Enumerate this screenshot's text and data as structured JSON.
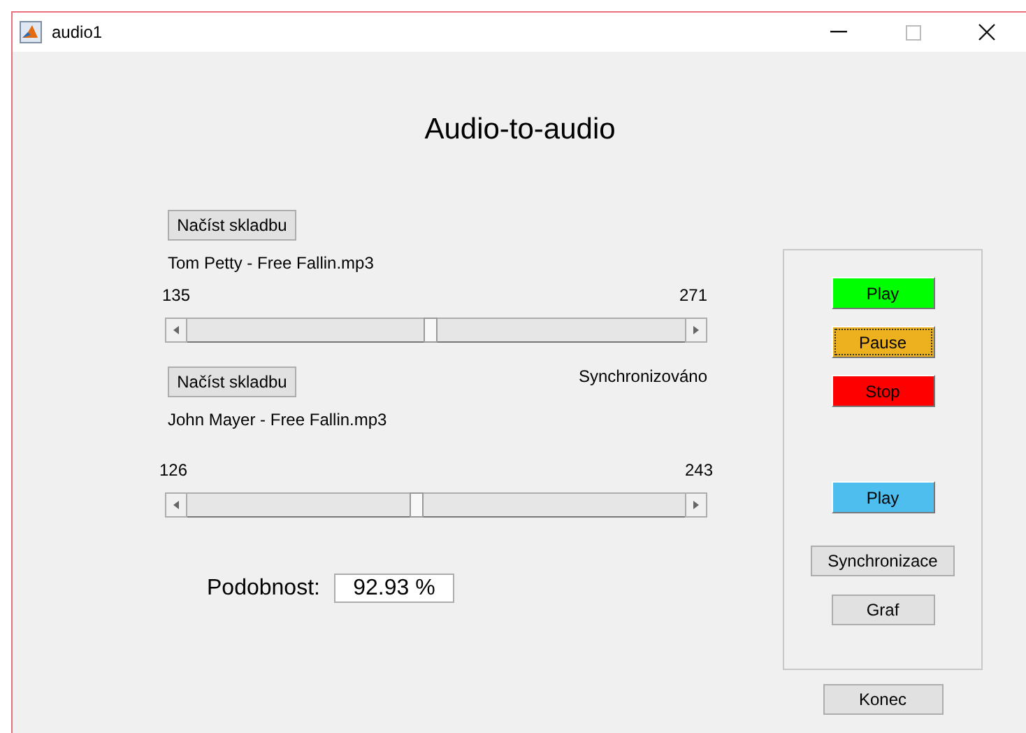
{
  "window": {
    "title": "audio1"
  },
  "heading": "Audio-to-audio",
  "tracks": [
    {
      "load_button": "Načíst skladbu",
      "file": "Tom Petty - Free Fallin.mp3",
      "min_label": "135",
      "max_label": "271",
      "level": 0.49
    },
    {
      "load_button": "Načíst skladbu",
      "file": "John Mayer - Free Fallin.mp3",
      "min_label": "126",
      "max_label": "243",
      "level": 0.46,
      "status": "Synchronizováno"
    }
  ],
  "similarity": {
    "label": "Podobnost:",
    "value": "92.93 %"
  },
  "panel_buttons": [
    {
      "label": "Play",
      "color": "#00ff00",
      "focused": false
    },
    {
      "label": "Pause",
      "color": "#edb120",
      "focused": true
    },
    {
      "label": "Stop",
      "color": "#ff0000",
      "focused": false
    },
    {
      "label": "Play",
      "color": "#4dbeee",
      "focused": false
    },
    {
      "label": "Synchronizace",
      "focused": false
    },
    {
      "label": "Graf",
      "focused": false
    }
  ],
  "exit_button": "Konec"
}
